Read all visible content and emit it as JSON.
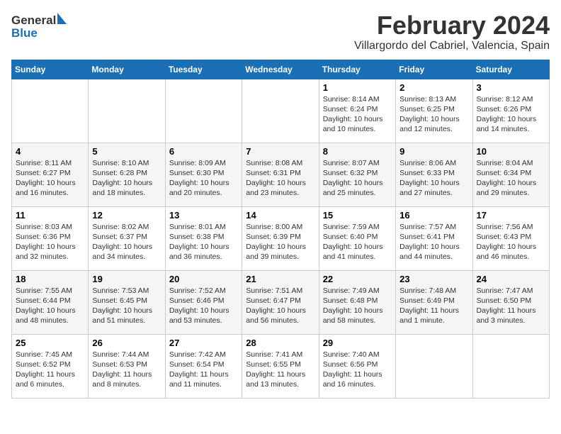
{
  "header": {
    "logo_line1": "General",
    "logo_line2": "Blue",
    "month": "February 2024",
    "location": "Villargordo del Cabriel, Valencia, Spain"
  },
  "columns": [
    "Sunday",
    "Monday",
    "Tuesday",
    "Wednesday",
    "Thursday",
    "Friday",
    "Saturday"
  ],
  "weeks": [
    [
      {
        "day": "",
        "info": ""
      },
      {
        "day": "",
        "info": ""
      },
      {
        "day": "",
        "info": ""
      },
      {
        "day": "",
        "info": ""
      },
      {
        "day": "1",
        "info": "Sunrise: 8:14 AM\nSunset: 6:24 PM\nDaylight: 10 hours\nand 10 minutes."
      },
      {
        "day": "2",
        "info": "Sunrise: 8:13 AM\nSunset: 6:25 PM\nDaylight: 10 hours\nand 12 minutes."
      },
      {
        "day": "3",
        "info": "Sunrise: 8:12 AM\nSunset: 6:26 PM\nDaylight: 10 hours\nand 14 minutes."
      }
    ],
    [
      {
        "day": "4",
        "info": "Sunrise: 8:11 AM\nSunset: 6:27 PM\nDaylight: 10 hours\nand 16 minutes."
      },
      {
        "day": "5",
        "info": "Sunrise: 8:10 AM\nSunset: 6:28 PM\nDaylight: 10 hours\nand 18 minutes."
      },
      {
        "day": "6",
        "info": "Sunrise: 8:09 AM\nSunset: 6:30 PM\nDaylight: 10 hours\nand 20 minutes."
      },
      {
        "day": "7",
        "info": "Sunrise: 8:08 AM\nSunset: 6:31 PM\nDaylight: 10 hours\nand 23 minutes."
      },
      {
        "day": "8",
        "info": "Sunrise: 8:07 AM\nSunset: 6:32 PM\nDaylight: 10 hours\nand 25 minutes."
      },
      {
        "day": "9",
        "info": "Sunrise: 8:06 AM\nSunset: 6:33 PM\nDaylight: 10 hours\nand 27 minutes."
      },
      {
        "day": "10",
        "info": "Sunrise: 8:04 AM\nSunset: 6:34 PM\nDaylight: 10 hours\nand 29 minutes."
      }
    ],
    [
      {
        "day": "11",
        "info": "Sunrise: 8:03 AM\nSunset: 6:36 PM\nDaylight: 10 hours\nand 32 minutes."
      },
      {
        "day": "12",
        "info": "Sunrise: 8:02 AM\nSunset: 6:37 PM\nDaylight: 10 hours\nand 34 minutes."
      },
      {
        "day": "13",
        "info": "Sunrise: 8:01 AM\nSunset: 6:38 PM\nDaylight: 10 hours\nand 36 minutes."
      },
      {
        "day": "14",
        "info": "Sunrise: 8:00 AM\nSunset: 6:39 PM\nDaylight: 10 hours\nand 39 minutes."
      },
      {
        "day": "15",
        "info": "Sunrise: 7:59 AM\nSunset: 6:40 PM\nDaylight: 10 hours\nand 41 minutes."
      },
      {
        "day": "16",
        "info": "Sunrise: 7:57 AM\nSunset: 6:41 PM\nDaylight: 10 hours\nand 44 minutes."
      },
      {
        "day": "17",
        "info": "Sunrise: 7:56 AM\nSunset: 6:43 PM\nDaylight: 10 hours\nand 46 minutes."
      }
    ],
    [
      {
        "day": "18",
        "info": "Sunrise: 7:55 AM\nSunset: 6:44 PM\nDaylight: 10 hours\nand 48 minutes."
      },
      {
        "day": "19",
        "info": "Sunrise: 7:53 AM\nSunset: 6:45 PM\nDaylight: 10 hours\nand 51 minutes."
      },
      {
        "day": "20",
        "info": "Sunrise: 7:52 AM\nSunset: 6:46 PM\nDaylight: 10 hours\nand 53 minutes."
      },
      {
        "day": "21",
        "info": "Sunrise: 7:51 AM\nSunset: 6:47 PM\nDaylight: 10 hours\nand 56 minutes."
      },
      {
        "day": "22",
        "info": "Sunrise: 7:49 AM\nSunset: 6:48 PM\nDaylight: 10 hours\nand 58 minutes."
      },
      {
        "day": "23",
        "info": "Sunrise: 7:48 AM\nSunset: 6:49 PM\nDaylight: 11 hours\nand 1 minute."
      },
      {
        "day": "24",
        "info": "Sunrise: 7:47 AM\nSunset: 6:50 PM\nDaylight: 11 hours\nand 3 minutes."
      }
    ],
    [
      {
        "day": "25",
        "info": "Sunrise: 7:45 AM\nSunset: 6:52 PM\nDaylight: 11 hours\nand 6 minutes."
      },
      {
        "day": "26",
        "info": "Sunrise: 7:44 AM\nSunset: 6:53 PM\nDaylight: 11 hours\nand 8 minutes."
      },
      {
        "day": "27",
        "info": "Sunrise: 7:42 AM\nSunset: 6:54 PM\nDaylight: 11 hours\nand 11 minutes."
      },
      {
        "day": "28",
        "info": "Sunrise: 7:41 AM\nSunset: 6:55 PM\nDaylight: 11 hours\nand 13 minutes."
      },
      {
        "day": "29",
        "info": "Sunrise: 7:40 AM\nSunset: 6:56 PM\nDaylight: 11 hours\nand 16 minutes."
      },
      {
        "day": "",
        "info": ""
      },
      {
        "day": "",
        "info": ""
      }
    ]
  ]
}
